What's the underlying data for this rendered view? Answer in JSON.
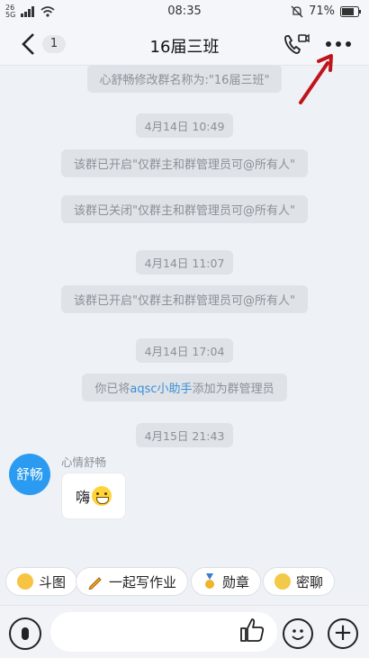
{
  "statusbar": {
    "left_top": "26",
    "left_bottom": "5G",
    "time": "08:35",
    "battery": "71%"
  },
  "header": {
    "back_icon": "chevron-left-icon",
    "unread_count": "1",
    "title": "16届三班",
    "call_icon": "video-call-icon",
    "more_icon": "more-dots-icon"
  },
  "messages": {
    "notice_rename": "心舒畅修改群名称为:\"16届三班\"",
    "time1": "4月14日 10:49",
    "notice_on1": "该群已开启\"仅群主和群管理员可@所有人\"",
    "notice_off": "该群已关闭\"仅群主和群管理员可@所有人\"",
    "time2": "4月14日 11:07",
    "notice_on2": "该群已开启\"仅群主和群管理员可@所有人\"",
    "time3": "4月14日 17:04",
    "admin_prefix": "你已将",
    "admin_link": "aqsc小助手",
    "admin_suffix": "添加为群管理员",
    "time4": "4月15日 21:43",
    "avatar_text": "舒畅",
    "sender_name": "心情舒畅",
    "bubble_text": "嗨"
  },
  "quick_actions": [
    {
      "label": "斗图",
      "icon": "sticker-face-icon",
      "color": "#f6c343"
    },
    {
      "label": "一起写作业",
      "icon": "pencil-icon",
      "color": "#f5a623"
    },
    {
      "label": "勋章",
      "icon": "medal-icon",
      "color": "#f0b429"
    },
    {
      "label": "密聊",
      "icon": "secret-chat-face-icon",
      "color": "#f3c94a"
    }
  ],
  "input": {
    "placeholder": "",
    "mic_icon": "mic-icon",
    "like_icon": "thumbs-up-icon",
    "emoji_icon": "emoji-icon",
    "plus_icon": "plus-icon"
  },
  "colors": {
    "accent": "#2a9bf0",
    "link": "#3a8fd6",
    "annotation_arrow": "#c0141a"
  }
}
